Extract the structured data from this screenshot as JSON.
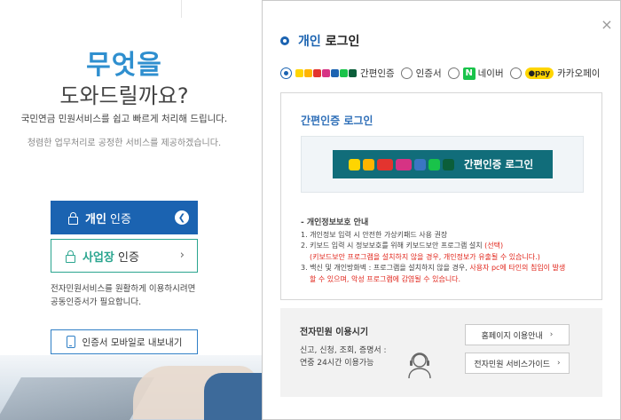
{
  "left": {
    "headline_line1": "무엇을",
    "headline_line2": "도와드릴까요?",
    "subtitle1": "국민연금 민원서비스를 쉽고 빠르게 처리해 드립니다.",
    "subtitle2": "청렴한 업무처리로 공정한 서비스를 제공하겠습니다.",
    "personal_btn_bold": "개인",
    "personal_btn_rest": " 인증",
    "business_btn_bold": "사업장",
    "business_btn_rest": " 인증",
    "notice_line1": "전자민원서비스를 원활하게 이용하시려면",
    "notice_line2": "공동인증서가 필요합니다.",
    "mobile_btn": "인증서 모바일로 내보내기"
  },
  "modal": {
    "title_blue": "개인",
    "title_dark": "로그인",
    "close_glyph": "×",
    "radio_options": [
      {
        "label": "간편인증",
        "selected": true
      },
      {
        "label": "인증서",
        "selected": false
      },
      {
        "label": "네이버",
        "selected": false
      },
      {
        "label": "카카오페이",
        "selected": false
      }
    ],
    "naver_letter": "N",
    "kakaopay_badge": "pay",
    "section_title": "간편인증 로그인",
    "easy_login_button": "간편인증 로그인",
    "privacy": {
      "heading": "- 개인정보보호 안내",
      "line1": "1. 개인정보 입력 시 안전한 가상키패드 사용 권장",
      "line2": "2. 키보드 입력 시 정보보호를 위해 키보드보안 프로그램 설치",
      "line2_red": "(선택)",
      "line3_red": "(키보드보안 프로그램을 설치하지 않을 경우, 개인정보가 유출될 수 있습니다.)",
      "line4": "3. 백신 및 개인방화벽 : 프로그램을 설치하지 않을 경우,",
      "line4_red": "사용자 pc에 타인의 침입이 발생",
      "line5_red": "할 수 있으며, 악성 프로그램에 감염될 수 있습니다."
    },
    "footer": {
      "title": "전자민원 이용시기",
      "line1": "신고, 신청, 조회, 증명서 :",
      "line2": "연중 24시간 이용가능",
      "btn_homepage": "홈페이지 이용안내",
      "btn_guide": "전자민원 서비스가이드"
    }
  },
  "colors": {
    "primary_blue": "#1b63b1",
    "teal_button": "#116d7a",
    "business_green": "#2aa58f",
    "warning_red": "#e1251b",
    "naver_green": "#19c34a",
    "kakao_yellow": "#ffd500"
  },
  "icons": [
    "lock-icon",
    "chevron-left-icon",
    "chevron-right-icon",
    "phone-icon",
    "close-icon",
    "headset-icon",
    "naver-icon",
    "kakaopay-icon"
  ]
}
